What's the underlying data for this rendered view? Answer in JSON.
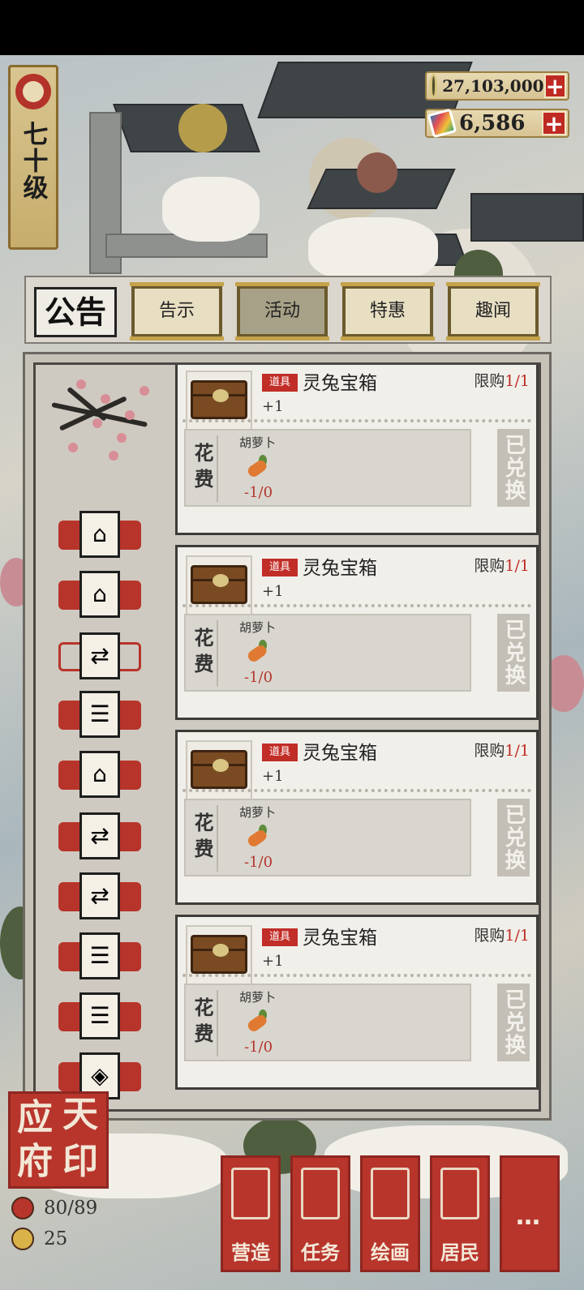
{
  "level": {
    "text": "七十级"
  },
  "currency": [
    {
      "name": "coins",
      "icon": "coin-icon",
      "value": "27,103,000"
    },
    {
      "name": "cards",
      "icon": "card-icon",
      "value": "6,586"
    }
  ],
  "plus_label": "+",
  "header": {
    "title": "公告",
    "tabs": [
      {
        "label": "告示",
        "active": false
      },
      {
        "label": "活动",
        "active": true
      },
      {
        "label": "特惠",
        "active": false
      },
      {
        "label": "趣闻",
        "active": false
      }
    ]
  },
  "sidebar": {
    "items": [
      {
        "icon": "house-icon",
        "glyph": "⌂",
        "selected": false
      },
      {
        "icon": "house-icon",
        "glyph": "⌂",
        "selected": false
      },
      {
        "icon": "exchange-icon",
        "glyph": "⇄",
        "selected": true
      },
      {
        "icon": "scroll-icon",
        "glyph": "☰",
        "selected": false
      },
      {
        "icon": "house-icon",
        "glyph": "⌂",
        "selected": false
      },
      {
        "icon": "exchange-icon",
        "glyph": "⇄",
        "selected": false
      },
      {
        "icon": "exchange-icon",
        "glyph": "⇄",
        "selected": false
      },
      {
        "icon": "scroll-icon",
        "glyph": "☰",
        "selected": false
      },
      {
        "icon": "scroll-icon",
        "glyph": "☰",
        "selected": false
      },
      {
        "icon": "gem-card-icon",
        "glyph": "◈",
        "selected": false
      }
    ]
  },
  "items": [
    {
      "tag": "道具",
      "name": "灵兔宝箱",
      "limit_label": "限购",
      "limit_value": "1/1",
      "qty": "+1",
      "cost_label": "花费",
      "cost_item": "胡萝卜",
      "cost_value": "-1/0",
      "status": "已兑换"
    },
    {
      "tag": "道具",
      "name": "灵兔宝箱",
      "limit_label": "限购",
      "limit_value": "1/1",
      "qty": "+1",
      "cost_label": "花费",
      "cost_item": "胡萝卜",
      "cost_value": "-1/0",
      "status": "已兑换"
    },
    {
      "tag": "道具",
      "name": "灵兔宝箱",
      "limit_label": "限购",
      "limit_value": "1/1",
      "qty": "+1",
      "cost_label": "花费",
      "cost_item": "胡萝卜",
      "cost_value": "-1/0",
      "status": "已兑换"
    },
    {
      "tag": "道具",
      "name": "灵兔宝箱",
      "limit_label": "限购",
      "limit_value": "1/1",
      "qty": "+1",
      "cost_label": "花费",
      "cost_item": "胡萝卜",
      "cost_value": "-1/0",
      "status": "已兑换"
    }
  ],
  "seal": {
    "chars": [
      "应",
      "天",
      "府",
      "印"
    ]
  },
  "stats": [
    {
      "icon": "population-icon",
      "value": "80/89"
    },
    {
      "icon": "resident-face-icon",
      "value": "25"
    }
  ],
  "menu": [
    {
      "label": "营造",
      "icon": "build-icon"
    },
    {
      "label": "任务",
      "icon": "task-book-icon"
    },
    {
      "label": "绘画",
      "icon": "painting-scroll-icon"
    },
    {
      "label": "居民",
      "icon": "resident-icon"
    },
    {
      "label": "…",
      "icon": "more-icon"
    }
  ]
}
